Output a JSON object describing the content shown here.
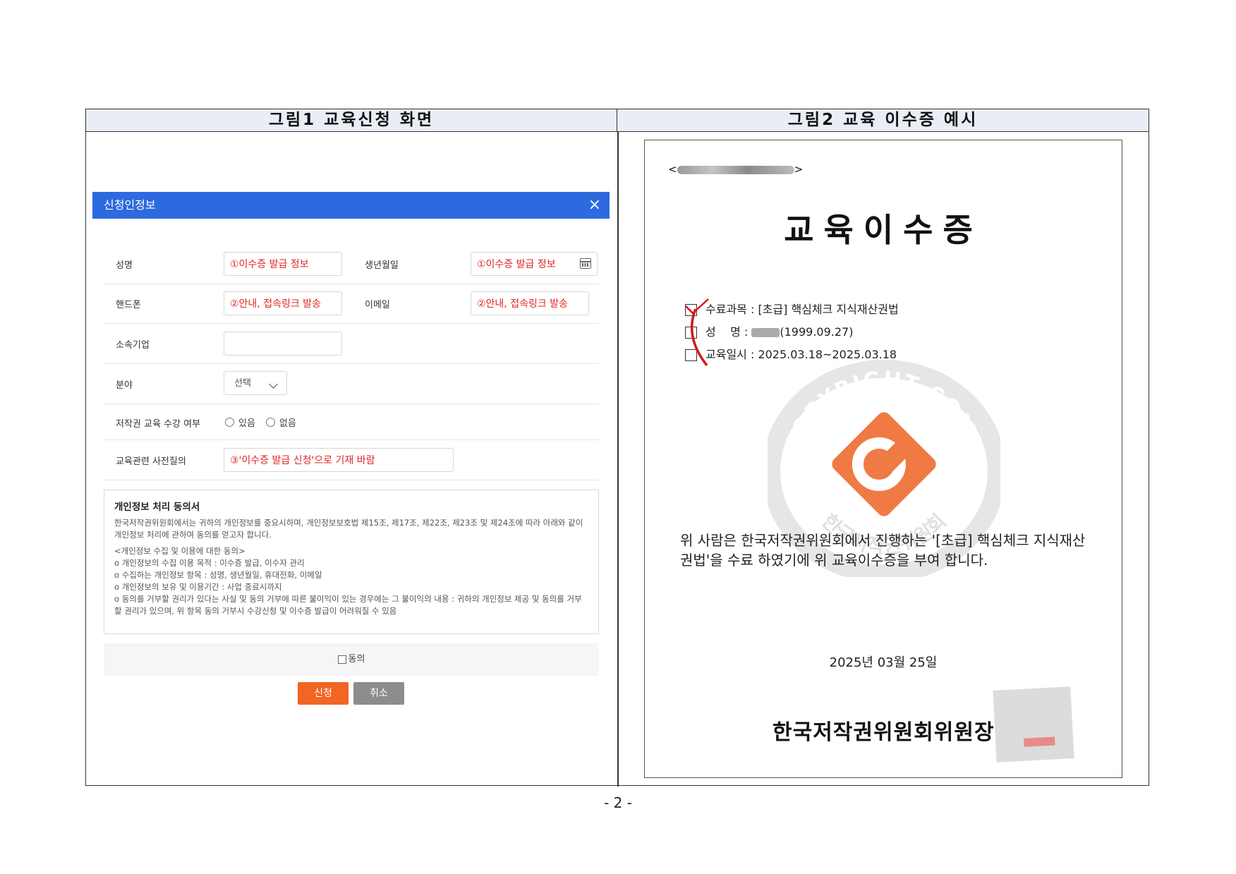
{
  "headers": {
    "left": "그림1 교육신청 화면",
    "right": "그림2 교육 이수증 예시"
  },
  "form": {
    "title": "신청인정보",
    "close_icon": "×",
    "fields": {
      "name_label": "성명",
      "name_value": "①이수증 발급 정보",
      "birth_label": "생년월일",
      "birth_value": "①이수증 발급 정보",
      "phone_label": "핸드폰",
      "phone_value": "②안내, 접속링크 발송",
      "email_label": "이메일",
      "email_value": "②안내, 접속링크 발송",
      "company_label": "소속기업",
      "company_value": "",
      "field_label": "분야",
      "field_select": "선택",
      "copyright_label": "저작권 교육 수강 여부",
      "radio_yes": "있음",
      "radio_no": "없음",
      "question_label": "교육관련 사전질의",
      "question_value": "③'이수증 발급 신청'으로 기재 바람"
    },
    "consent": {
      "heading": "개인정보 처리 동의서",
      "intro": "한국저작권위원회에서는 귀하의 개인정보를 중요시하며, 개인정보보호법 제15조, 제17조, 제22조, 제23조 및 제24조에 따라 아래와 같이 개인정보 처리에 관하여 동의를 얻고자 합니다.",
      "subheading": "<개인정보 수집 및 이용에 대한 동의>",
      "line1": "o 개인정보의 수집 이용 목적 : 이수증 발급, 이수자 관리",
      "line2": "o 수집하는 개인정보 항목 : 성명, 생년월일, 휴대전화, 이메일",
      "line3": "o 개인정보의 보유 및 이용기간 : 사업 종료시까지",
      "line4": "o 동의를 거부할 권리가 있다는 사실 및 동의 거부에 따른 불이익이 있는 경우에는 그 불이익의 내용 : 귀하의 개인정보 제공 및 동의를 거부할 권리가 있으며, 위 항목 동의 거부시 수강신청 및 이수증 발급이 어려워질 수 있음"
    },
    "agree_label": "동의",
    "apply_button": "신청",
    "cancel_button": "취소"
  },
  "certificate": {
    "number_prefix": "<",
    "number_suffix": ">",
    "title": "교육이수증",
    "course": "수료과목 : [초급] 핵심체크 지식재산권법",
    "name_label": "성    명 : ",
    "name_suffix": "(1999.09.27)",
    "date_range": "교육일시 : 2025.03.18~2025.03.18",
    "body": "위 사람은 한국저작권위원회에서 진행하는 '[초급] 핵심체크 지식재산권법'을 수료 하였기에 위 교육이수증을 부여 합니다.",
    "issue_date": "2025년 03월 25일",
    "issuer": "한국저작권위원회위원장",
    "seal_text_top": "KOREA COPYRIGHT COMMISSION",
    "seal_text_bottom": "한국저작권위원회",
    "colors": {
      "seal_orange": "#f07a44",
      "seal_gray": "#e3e3e3",
      "pen_red": "#d11a1a"
    }
  },
  "page_number": "- 2 -",
  "colors": {
    "form_titlebar": "#2d6ae0",
    "apply": "#f26522",
    "cancel": "#8c8c8c",
    "red_text": "#e02424"
  }
}
